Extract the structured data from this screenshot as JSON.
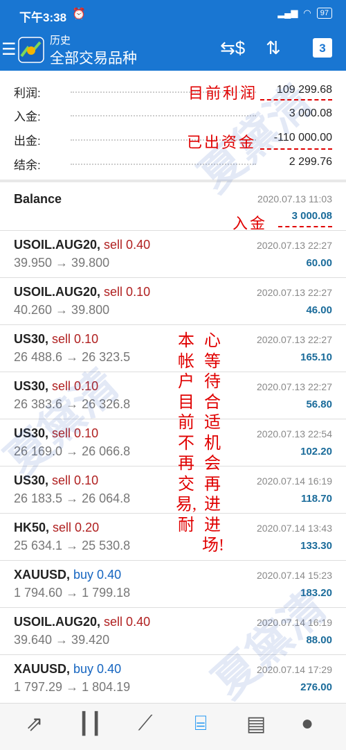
{
  "status_bar": {
    "time": "下午3:38",
    "alarm_icon": "alarm-icon",
    "battery": "97"
  },
  "app_bar": {
    "subtitle": "历史",
    "title": "全部交易品种",
    "calendar_day": "3"
  },
  "summary": {
    "profit": {
      "label": "利润:",
      "value": "109 299.68"
    },
    "deposit": {
      "label": "入金:",
      "value": "3 000.08"
    },
    "withdrawal": {
      "label": "出金:",
      "value": "-110 000.00"
    },
    "balance": {
      "label": "结余:",
      "value": "2 299.76"
    }
  },
  "balance_entry": {
    "label": "Balance",
    "datetime": "2020.07.13 11:03",
    "amount": "3 000.08"
  },
  "trades": [
    {
      "symbol": "USOIL.AUG20,",
      "side": "sell 0.40",
      "side_type": "sell",
      "prices": "39.950 → 39.800",
      "datetime": "2020.07.13 22:27",
      "profit": "60.00"
    },
    {
      "symbol": "USOIL.AUG20,",
      "side": "sell 0.10",
      "side_type": "sell",
      "prices": "40.260 → 39.800",
      "datetime": "2020.07.13 22:27",
      "profit": "46.00"
    },
    {
      "symbol": "US30,",
      "side": "sell 0.10",
      "side_type": "sell",
      "prices": "26 488.6 → 26 323.5",
      "datetime": "2020.07.13 22:27",
      "profit": "165.10"
    },
    {
      "symbol": "US30,",
      "side": "sell 0.10",
      "side_type": "sell",
      "prices": "26 383.6 → 26 326.8",
      "datetime": "2020.07.13 22:27",
      "profit": "56.80"
    },
    {
      "symbol": "US30,",
      "side": "sell 0.10",
      "side_type": "sell",
      "prices": "26 169.0 → 26 066.8",
      "datetime": "2020.07.13 22:54",
      "profit": "102.20"
    },
    {
      "symbol": "US30,",
      "side": "sell 0.10",
      "side_type": "sell",
      "prices": "26 183.5 → 26 064.8",
      "datetime": "2020.07.14 16:19",
      "profit": "118.70"
    },
    {
      "symbol": "HK50,",
      "side": "sell 0.20",
      "side_type": "sell",
      "prices": "25 634.1 → 25 530.8",
      "datetime": "2020.07.14 13:43",
      "profit": "133.30"
    },
    {
      "symbol": "XAUUSD,",
      "side": "buy 0.40",
      "side_type": "buy",
      "prices": "1 794.60 → 1 799.18",
      "datetime": "2020.07.14 15:23",
      "profit": "183.20"
    },
    {
      "symbol": "USOIL.AUG20,",
      "side": "sell 0.40",
      "side_type": "sell",
      "prices": "39.640 → 39.420",
      "datetime": "2020.07.14 16:19",
      "profit": "88.00"
    },
    {
      "symbol": "XAUUSD,",
      "side": "buy 0.40",
      "side_type": "buy",
      "prices": "1 797.29 → 1 804.19",
      "datetime": "2020.07.14 17:29",
      "profit": "276.00"
    }
  ],
  "annotations": {
    "current_profit": "目前利润",
    "withdrawn": "已出资金",
    "deposit": "入金",
    "column_left": "本帐户目前不再交易,耐",
    "column_right": "心等待合适机会再进进场!"
  },
  "watermark": "夏黛清",
  "bottom_nav": [
    "quotes-icon",
    "chart-icon",
    "trade-icon",
    "history-icon",
    "news-icon",
    "messages-icon"
  ],
  "colors": {
    "primary": "#1976d2",
    "sell": "#b02020",
    "buy": "#1565c0",
    "profit": "#1a6b9a",
    "annotation": "#e00000"
  }
}
